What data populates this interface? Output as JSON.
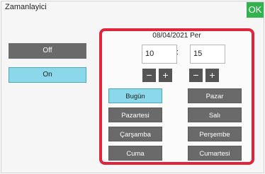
{
  "window": {
    "title": "Zamanlayici",
    "ok_label": "OK"
  },
  "toggle": {
    "off_label": "Off",
    "on_label": "On",
    "selected": "On"
  },
  "schedule": {
    "date_label": "08/04/2021 Per",
    "hour_value": "10",
    "minute_value": "15",
    "separator": ":",
    "minus_label": "−",
    "plus_label": "+",
    "days": [
      {
        "label": "Bugün",
        "selected": true
      },
      {
        "label": "Pazar",
        "selected": false
      },
      {
        "label": "Pazartesi",
        "selected": false
      },
      {
        "label": "Salı",
        "selected": false
      },
      {
        "label": "Çarşamba",
        "selected": false
      },
      {
        "label": "Perşembe",
        "selected": false
      },
      {
        "label": "Cuma",
        "selected": false
      },
      {
        "label": "Cumartesi",
        "selected": false
      }
    ]
  },
  "colors": {
    "accent_highlight": "#e0243b",
    "selected_fill": "#8ad8e9",
    "ok_green": "#33b24f"
  }
}
